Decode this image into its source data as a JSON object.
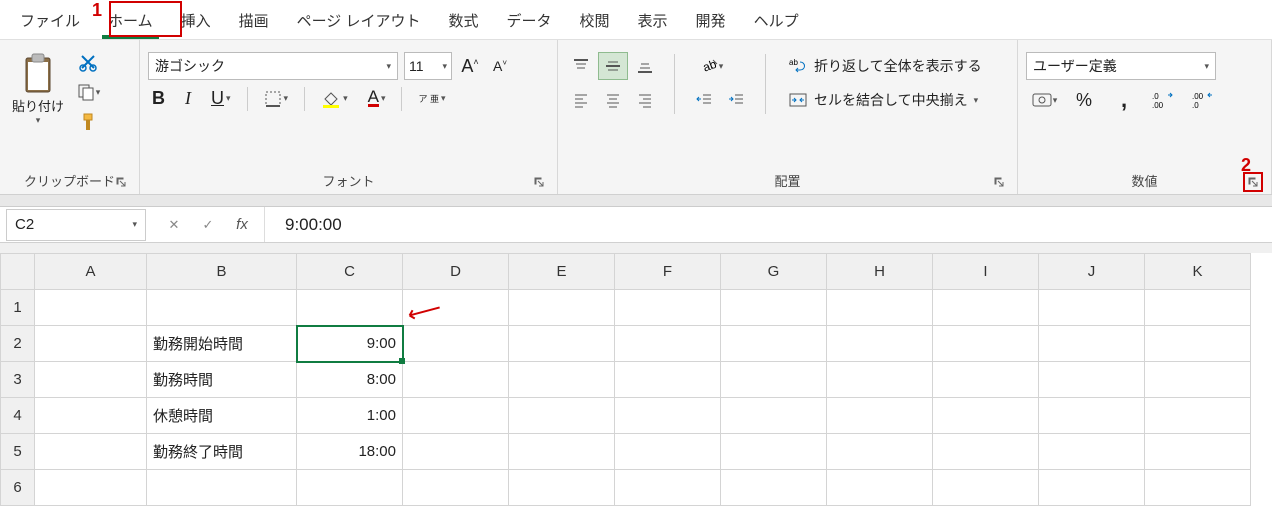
{
  "tabs": {
    "file": "ファイル",
    "home": "ホーム",
    "insert": "挿入",
    "draw": "描画",
    "pagelayout": "ページ レイアウト",
    "formulas": "数式",
    "data": "データ",
    "review": "校閲",
    "view": "表示",
    "developer": "開発",
    "help": "ヘルプ"
  },
  "callouts": {
    "one": "1",
    "two": "2"
  },
  "ribbon": {
    "clipboard": {
      "paste": "貼り付け",
      "label": "クリップボード"
    },
    "font": {
      "family": "游ゴシック",
      "size": "11",
      "phonetic": "ア\n亜",
      "label": "フォント"
    },
    "alignment": {
      "wrap": "折り返して全体を表示する",
      "merge": "セルを結合して中央揃え",
      "label": "配置"
    },
    "number": {
      "format": "ユーザー定義",
      "label": "数値"
    }
  },
  "namebox": "C2",
  "formula": "9:00:00",
  "columns": [
    "A",
    "B",
    "C",
    "D",
    "E",
    "F",
    "G",
    "H",
    "I",
    "J",
    "K"
  ],
  "rows": [
    {
      "n": "1",
      "B": "",
      "C": ""
    },
    {
      "n": "2",
      "B": "勤務開始時間",
      "C": "9:00"
    },
    {
      "n": "3",
      "B": "勤務時間",
      "C": "8:00"
    },
    {
      "n": "4",
      "B": "休憩時間",
      "C": "1:00"
    },
    {
      "n": "5",
      "B": "勤務終了時間",
      "C": "18:00"
    },
    {
      "n": "6",
      "B": "",
      "C": ""
    }
  ]
}
